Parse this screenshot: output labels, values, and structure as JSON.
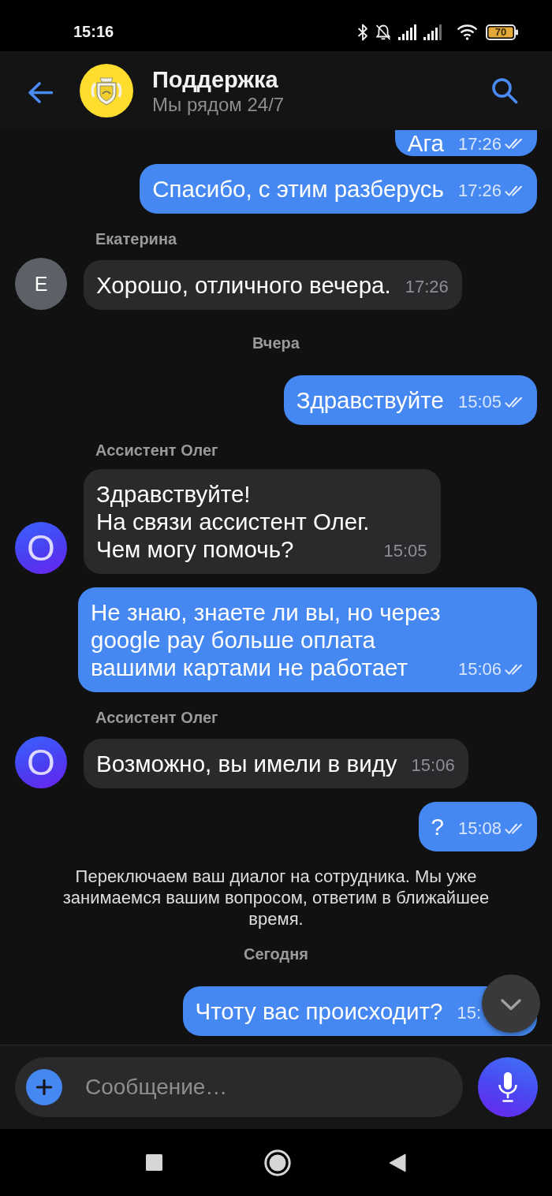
{
  "status_bar": {
    "time": "15:16",
    "battery": "70"
  },
  "header": {
    "title": "Поддержка",
    "subtitle": "Мы рядом 24/7"
  },
  "messages": [
    {
      "kind": "outgoing",
      "text": "Ага",
      "time": "17:26",
      "read": true,
      "clipped_top": true
    },
    {
      "kind": "outgoing",
      "text": "Спасибо, с этим разберусь",
      "time": "17:26",
      "read": true
    },
    {
      "kind": "incoming",
      "sender": "Екатерина",
      "avatar": {
        "letter": "Е",
        "kind": "operator"
      },
      "text": "Хорошо, отличного вечера.",
      "time": "17:26"
    },
    {
      "kind": "date",
      "text": "Вчера"
    },
    {
      "kind": "outgoing",
      "text": "Здравствуйте",
      "time": "15:05",
      "read": true
    },
    {
      "kind": "incoming",
      "sender": "Ассистент Олег",
      "avatar": {
        "letter": "О",
        "kind": "bot"
      },
      "text": "Здравствуйте!\nНа связи ассистент Олег.\nЧем могу помочь?",
      "time": "15:05"
    },
    {
      "kind": "outgoing",
      "text": "Не знаю, знаете ли вы, но через google pay больше оплата вашими картами не работает",
      "time": "15:06",
      "read": true
    },
    {
      "kind": "incoming",
      "sender": "Ассистент Олег",
      "avatar": {
        "letter": "О",
        "kind": "bot"
      },
      "text": "Возможно, вы имели в виду",
      "time": "15:06"
    },
    {
      "kind": "outgoing",
      "text": "?",
      "time": "15:08",
      "read": true
    },
    {
      "kind": "notice",
      "text": "Переключаем ваш диалог на сотрудника. Мы уже занимаемся вашим вопросом, ответим в ближайшее время."
    },
    {
      "kind": "date",
      "text": "Сегодня"
    },
    {
      "kind": "outgoing",
      "text": "Чтоту вас происходит?",
      "time": "15:"
    }
  ],
  "composer": {
    "placeholder": "Сообщение…"
  }
}
